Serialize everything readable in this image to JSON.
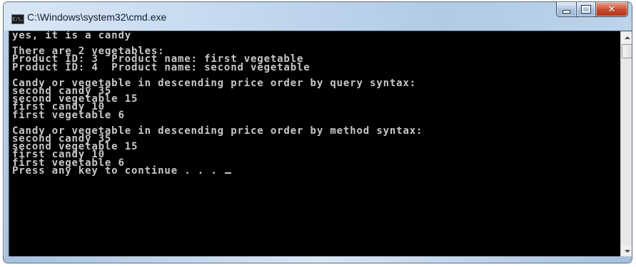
{
  "window": {
    "title": "C:\\Windows\\system32\\cmd.exe",
    "icon": "cmd-console-icon",
    "icon_text": "C:\\.",
    "caption_buttons": [
      "minimize",
      "maximize",
      "close"
    ]
  },
  "console": {
    "lines": [
      "yes, it is a candy",
      "",
      "There are 2 vegetables:",
      "Product ID: 3  Product name: first vegetable",
      "Product ID: 4  Product name: second vegetable",
      "",
      "Candy or vegetable in descending price order by query syntax:",
      "second candy 35",
      "second vegetable 15",
      "first candy 10",
      "first vegetable 6",
      "",
      "Candy or vegetable in descending price order by method syntax:",
      "second candy 35",
      "second vegetable 15",
      "first candy 10",
      "first vegetable 6",
      "Press any key to continue . . . "
    ],
    "colors": {
      "background": "#000000",
      "foreground": "#c8c8c8"
    }
  },
  "scrollbar": {
    "position_fraction": 0.0
  }
}
